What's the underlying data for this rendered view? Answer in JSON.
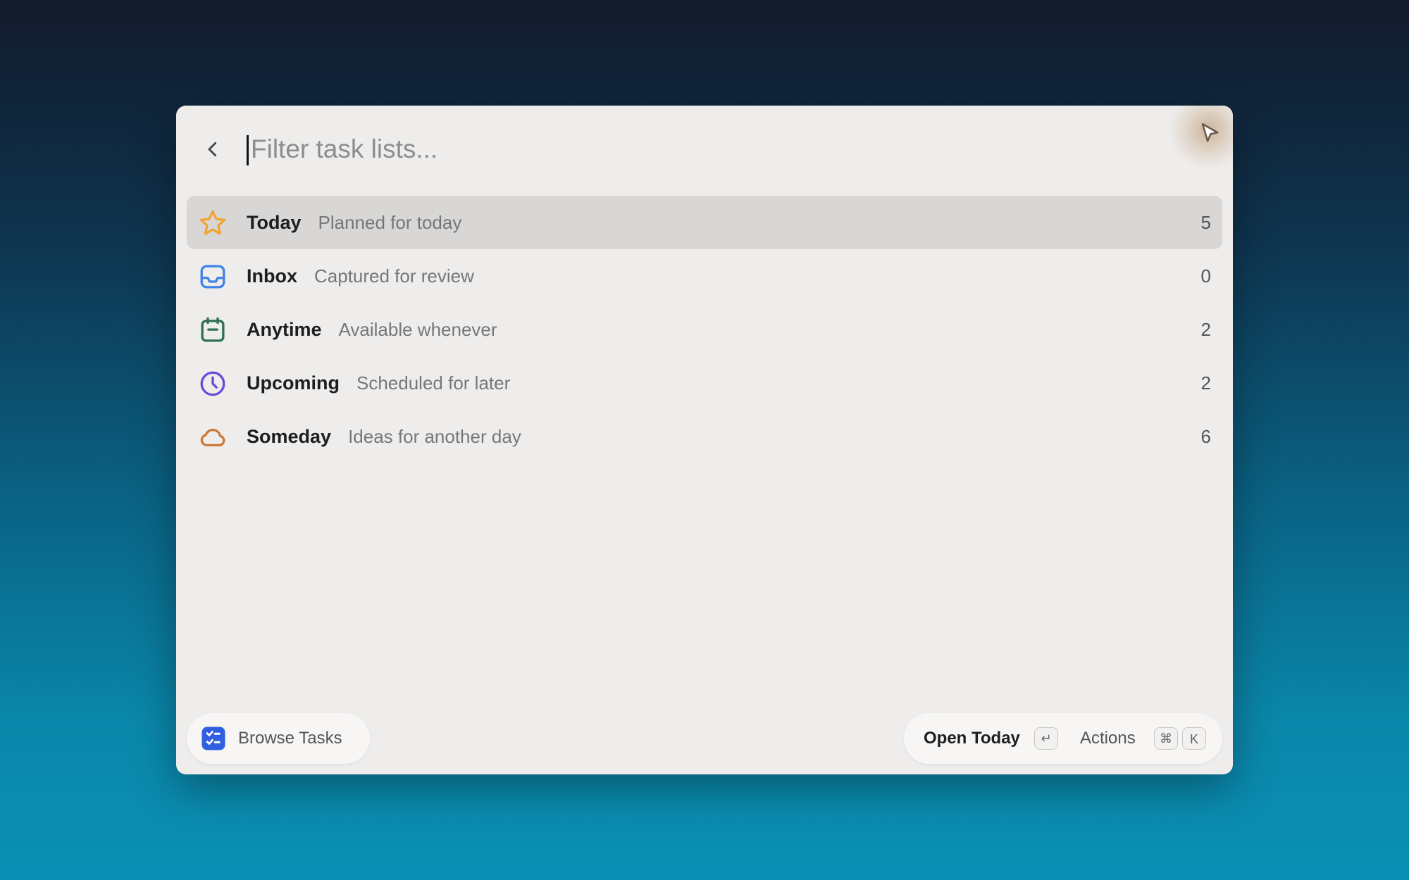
{
  "search": {
    "placeholder": "Filter task lists..."
  },
  "lists": [
    {
      "title": "Today",
      "subtitle": "Planned for today",
      "count": "5",
      "icon": "star-icon",
      "color": "#f0a531",
      "selected": true
    },
    {
      "title": "Inbox",
      "subtitle": "Captured for review",
      "count": "0",
      "icon": "inbox-tray-icon",
      "color": "#3f83e8",
      "selected": false
    },
    {
      "title": "Anytime",
      "subtitle": "Available whenever",
      "count": "2",
      "icon": "calendar-icon",
      "color": "#2f6f56",
      "selected": false
    },
    {
      "title": "Upcoming",
      "subtitle": "Scheduled for later",
      "count": "2",
      "icon": "clock-icon",
      "color": "#6b49d8",
      "selected": false
    },
    {
      "title": "Someday",
      "subtitle": "Ideas for another day",
      "count": "6",
      "icon": "cloud-icon",
      "color": "#cc7a3a",
      "selected": false
    }
  ],
  "footer": {
    "browse_label": "Browse Tasks",
    "primary_action": "Open Today",
    "enter_key": "↵",
    "actions_label": "Actions",
    "cmd_key": "⌘",
    "k_key": "K"
  },
  "colors": {
    "accent_blue": "#2f5fe0",
    "selected_row": "#d8d7d6",
    "window_bg": "#eeedec"
  }
}
